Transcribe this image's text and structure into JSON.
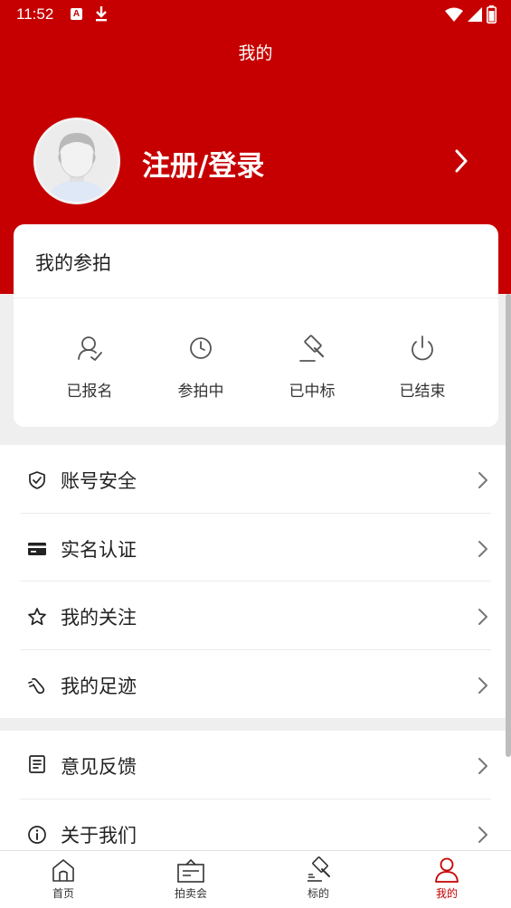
{
  "status_bar": {
    "time": "11:52",
    "a_badge": "A"
  },
  "header": {
    "title": "我的",
    "login_label": "注册/登录"
  },
  "auction_card": {
    "title": "我的参拍",
    "items": [
      {
        "label": "已报名",
        "icon": "user-check-icon"
      },
      {
        "label": "参拍中",
        "icon": "clock-icon"
      },
      {
        "label": "已中标",
        "icon": "gavel-icon"
      },
      {
        "label": "已结束",
        "icon": "power-icon"
      }
    ]
  },
  "menu": {
    "group1": [
      {
        "label": "账号安全",
        "icon": "shield-check-icon"
      },
      {
        "label": "实名认证",
        "icon": "id-card-icon"
      },
      {
        "label": "我的关注",
        "icon": "star-icon"
      },
      {
        "label": "我的足迹",
        "icon": "footprint-icon"
      }
    ],
    "group2": [
      {
        "label": "意见反馈",
        "icon": "feedback-icon"
      },
      {
        "label": "关于我们",
        "icon": "info-icon"
      }
    ]
  },
  "tabbar": {
    "items": [
      {
        "label": "首页",
        "icon": "home-icon"
      },
      {
        "label": "拍卖会",
        "icon": "auction-icon"
      },
      {
        "label": "标的",
        "icon": "lot-icon"
      },
      {
        "label": "我的",
        "icon": "profile-icon"
      }
    ],
    "active_index": 3
  },
  "colors": {
    "brand_red": "#c60000",
    "background": "#efefef"
  }
}
